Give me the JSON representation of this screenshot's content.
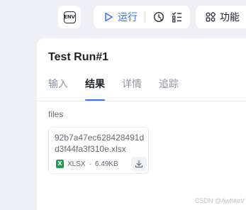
{
  "toolbar": {
    "env_icon_text": "ENV",
    "run_label": "运行",
    "function_label": "功能"
  },
  "panel": {
    "title": "Test Run#1",
    "tabs": [
      {
        "label": "输入",
        "active": false
      },
      {
        "label": "结果",
        "active": true
      },
      {
        "label": "详情",
        "active": false
      },
      {
        "label": "追踪",
        "active": false
      }
    ],
    "section_label": "files",
    "file": {
      "name": "92b7a47ec628428491dd3f44fa3f310e.xlsx",
      "type_icon": "X",
      "type": "XLSX",
      "separator": "·",
      "size": "6.49KB"
    }
  },
  "watermark": "CSDN @AwhiteV",
  "colors": {
    "accent": "#3370ff",
    "excel_green": "#1f9d55",
    "background": "#eef0f5"
  }
}
